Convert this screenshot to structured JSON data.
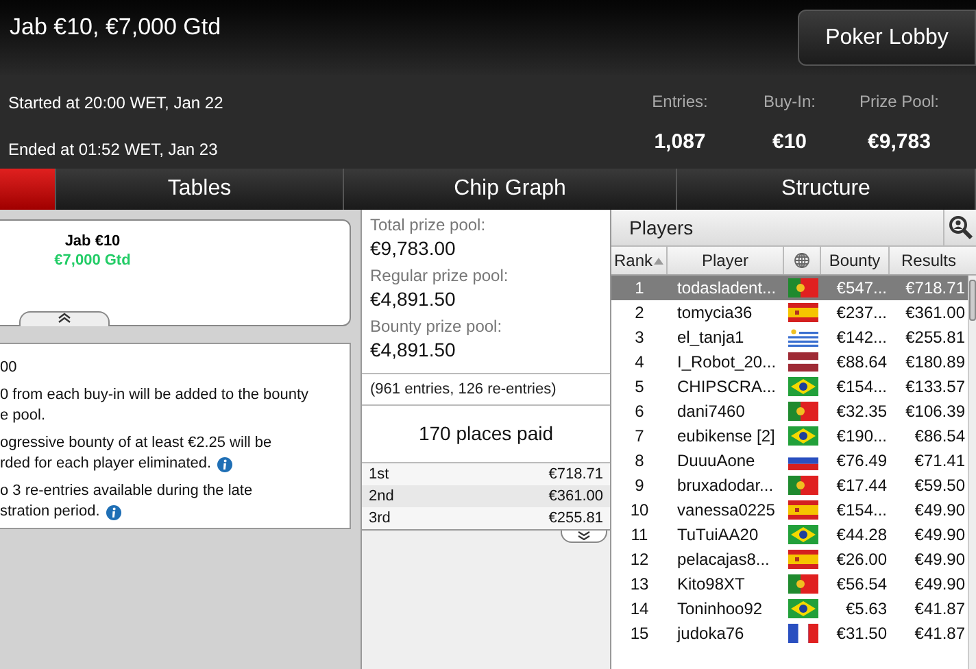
{
  "window": {
    "title": "Jab €10, €7,000 Gtd",
    "lobby_button": "Poker Lobby"
  },
  "info": {
    "started": "Started at 20:00 WET, Jan 22",
    "ended": "Ended at 01:52 WET, Jan 23",
    "stats": [
      {
        "label": "Entries:",
        "value": "1,087"
      },
      {
        "label": "Buy-In:",
        "value": "€10"
      },
      {
        "label": "Prize Pool:",
        "value": "€9,783"
      }
    ]
  },
  "tabs": [
    {
      "selected": true
    },
    {
      "label": "Tables",
      "selected": false
    },
    {
      "label": "Chip Graph",
      "selected": false
    },
    {
      "label": "Structure",
      "selected": false
    }
  ],
  "tournament_card": {
    "name": "Jab €10",
    "guarantee": "€7,000 Gtd"
  },
  "details": [
    {
      "lines": [
        "00"
      ],
      "info": false
    },
    {
      "lines": [
        "0 from each buy-in will be added to the bounty",
        "e pool."
      ],
      "info": false
    },
    {
      "lines": [
        "ogressive bounty of at least €2.25 will be",
        "rded for each player eliminated."
      ],
      "info": true
    },
    {
      "lines": [
        "o 3 re-entries available during the late",
        "stration period."
      ],
      "info": true
    }
  ],
  "prize_pool": [
    {
      "label": "Total prize pool:",
      "value": "€9,783.00"
    },
    {
      "label": "Regular prize pool:",
      "value": "€4,891.50"
    },
    {
      "label": "Bounty prize pool:",
      "value": "€4,891.50"
    }
  ],
  "entries_note": "(961 entries, 126 re-entries)",
  "places_paid": "170 places paid",
  "payouts": [
    {
      "place": "1st",
      "amount": "€718.71"
    },
    {
      "place": "2nd",
      "amount": "€361.00"
    },
    {
      "place": "3rd",
      "amount": "€255.81"
    }
  ],
  "players": {
    "title": "Players",
    "columns": [
      "Rank",
      "Player",
      "Bounty",
      "Results"
    ],
    "rows": [
      {
        "rank": "1",
        "player": "todasladent...",
        "kind": "pt",
        "bounty": "€547...",
        "results": "€718.71",
        "selected": true
      },
      {
        "rank": "2",
        "player": "tomycia36",
        "kind": "es",
        "bounty": "€237...",
        "results": "€361.00",
        "selected": false
      },
      {
        "rank": "3",
        "player": "el_tanja1",
        "kind": "uy",
        "bounty": "€142...",
        "results": "€255.81",
        "selected": false
      },
      {
        "rank": "4",
        "player": "I_Robot_20...",
        "kind": "lv",
        "bounty": "€88.64",
        "results": "€180.89",
        "selected": false
      },
      {
        "rank": "5",
        "player": "CHIPSCRA...",
        "kind": "br",
        "bounty": "€154...",
        "results": "€133.57",
        "selected": false
      },
      {
        "rank": "6",
        "player": "dani7460",
        "kind": "pt",
        "bounty": "€32.35",
        "results": "€106.39",
        "selected": false
      },
      {
        "rank": "7",
        "player": "eubikense [2]",
        "kind": "br",
        "bounty": "€190...",
        "results": "€86.54",
        "selected": false
      },
      {
        "rank": "8",
        "player": "DuuuAone",
        "kind": "ru",
        "bounty": "€76.49",
        "results": "€71.41",
        "selected": false
      },
      {
        "rank": "9",
        "player": "bruxadodar...",
        "kind": "pt",
        "bounty": "€17.44",
        "results": "€59.50",
        "selected": false
      },
      {
        "rank": "10",
        "player": "vanessa0225",
        "kind": "es",
        "bounty": "€154...",
        "results": "€49.90",
        "selected": false
      },
      {
        "rank": "11",
        "player": "TuTuiAA20",
        "kind": "br",
        "bounty": "€44.28",
        "results": "€49.90",
        "selected": false
      },
      {
        "rank": "12",
        "player": "pelacajas8...",
        "kind": "es",
        "bounty": "€26.00",
        "results": "€49.90",
        "selected": false
      },
      {
        "rank": "13",
        "player": "Kito98XT",
        "kind": "pt",
        "bounty": "€56.54",
        "results": "€49.90",
        "selected": false
      },
      {
        "rank": "14",
        "player": "Toninhoo92",
        "kind": "br",
        "bounty": "€5.63",
        "results": "€41.87",
        "selected": false
      },
      {
        "rank": "15",
        "player": "judoka76",
        "kind": "fr",
        "bounty": "€31.50",
        "results": "€41.87",
        "selected": false
      }
    ]
  }
}
